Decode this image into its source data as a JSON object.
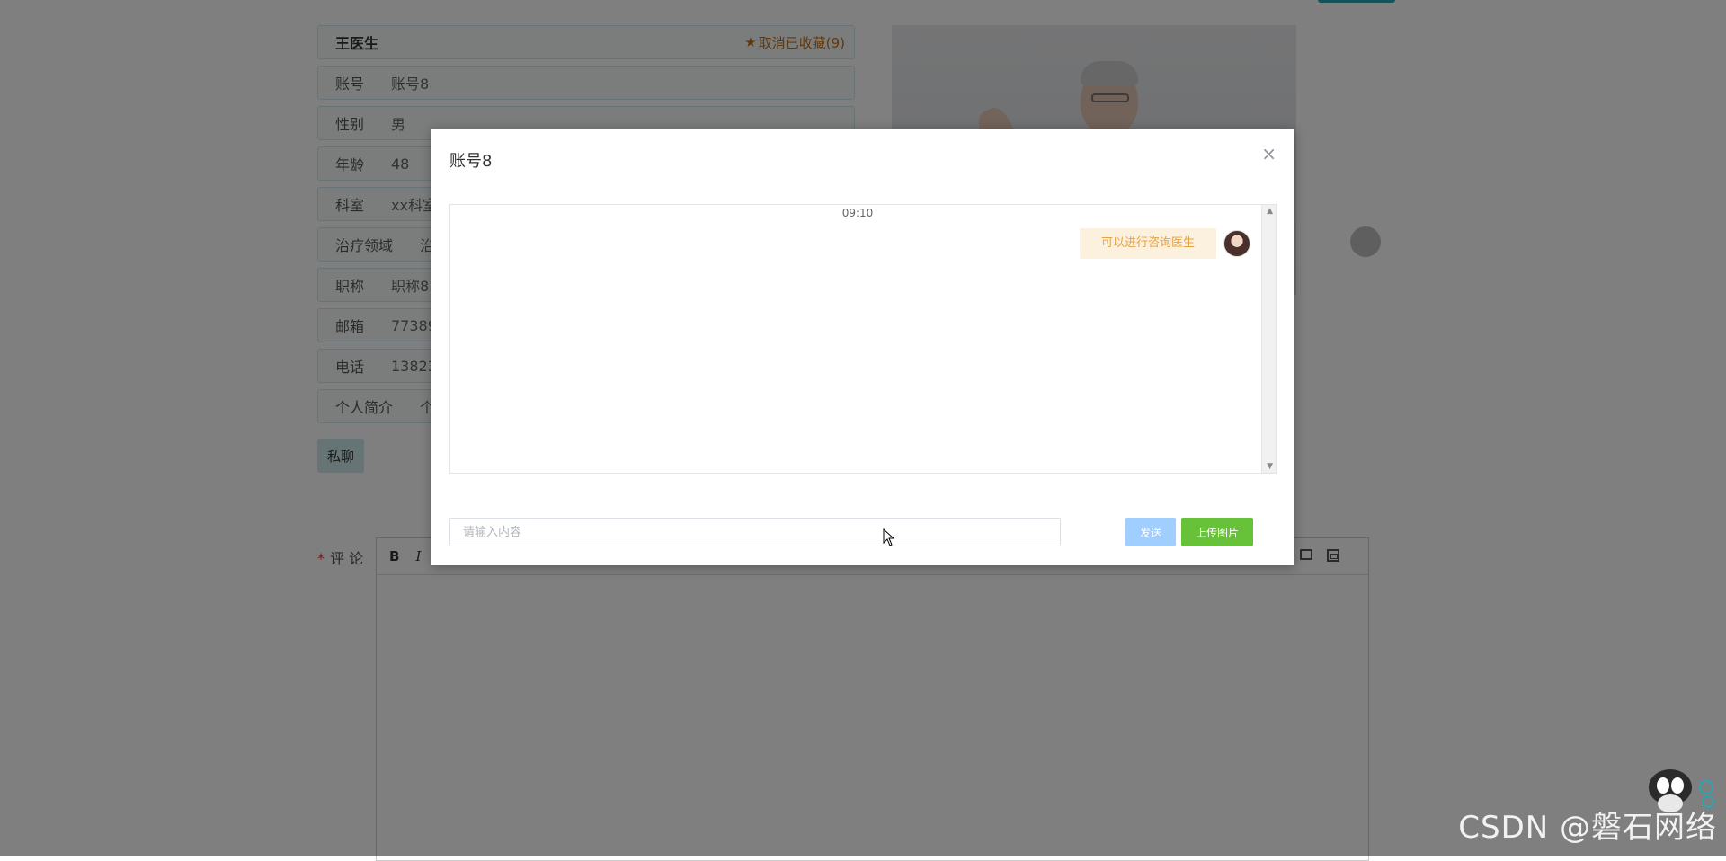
{
  "doctor_info": {
    "name": "王医生",
    "favorite_label": "取消已收藏(9)",
    "rows": [
      {
        "label": "账号",
        "value": "账号8"
      },
      {
        "label": "性别",
        "value": "男"
      },
      {
        "label": "年龄",
        "value": "48"
      },
      {
        "label": "科室",
        "value": "xx科室"
      },
      {
        "label": "治疗领域",
        "value": "治"
      },
      {
        "label": "职称",
        "value": "职称8"
      },
      {
        "label": "邮箱",
        "value": "77389"
      },
      {
        "label": "电话",
        "value": "13823"
      },
      {
        "label": "个人简介",
        "value": "个"
      }
    ],
    "chat_button_label": "私聊"
  },
  "comment": {
    "required_mark": "*",
    "label": "评 论",
    "toolbar": {
      "bold": "B",
      "italic": "I"
    }
  },
  "modal": {
    "title": "账号8",
    "close_symbol": "×",
    "messages": [
      {
        "time": "09:10",
        "text": "可以进行咨询医生",
        "side": "right"
      }
    ],
    "input_placeholder": "请输入内容",
    "send_label": "发送",
    "upload_label": "上传图片"
  },
  "watermark": "CSDN @磐石网络",
  "colors": {
    "accent": "#2aa6b2",
    "favorite": "#c0711c",
    "bubble_bg": "#fcf0df",
    "bubble_text": "#e6a23c",
    "send_button": "#a0cfff",
    "upload_button": "#67c23a"
  },
  "icons": {
    "favorite": "star-icon",
    "close": "close-icon",
    "image": "image-icon",
    "video": "video-icon"
  }
}
